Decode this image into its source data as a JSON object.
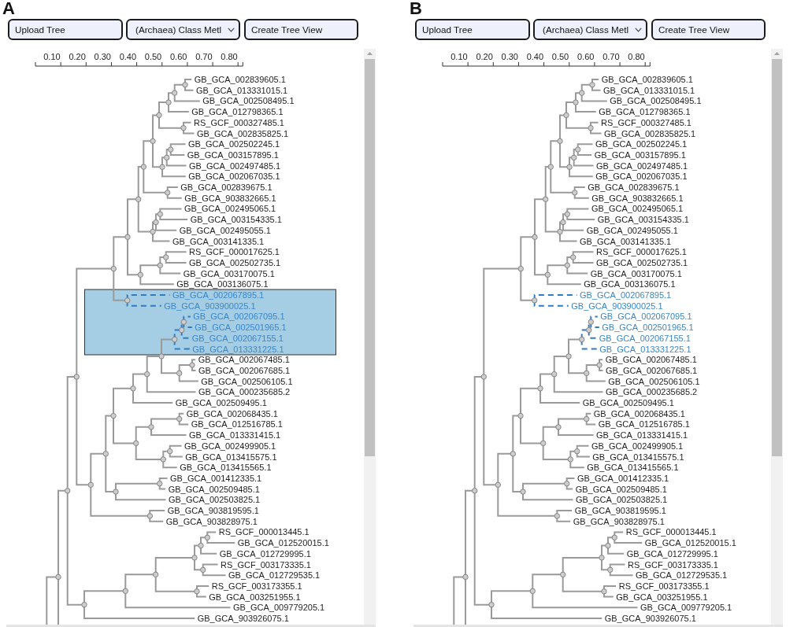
{
  "panels": [
    {
      "label": "A",
      "toolbar": {
        "upload_button": {
          "label": "Upload Tree"
        },
        "class_dropdown": {
          "value": "(Archaea) Class Metl"
        },
        "create_button": {
          "label": "Create Tree View"
        }
      },
      "scale": {
        "tick_labels": [
          "0.10",
          "0.20",
          "0.30",
          "0.40",
          "0.50",
          "0.60",
          "0.70",
          "0.80"
        ]
      },
      "brush_selection": true,
      "tree": {
        "children": [
          {
            "children": [
              {
                "children": [
                  {
                    "children": [
                      {
                        "children": [
                          {
                            "children": [
                              {
                                "children": [
                                  {
                                    "children": [
                                      {
                                        "children": [
                                          {
                                            "children": [
                                              {
                                                "children": [
                                                  {
                                                    "label": "GB_GCA_002839605.1",
                                                    "selected": false
                                                  },
                                                  {
                                                    "label": "GB_GCA_013331015.1",
                                                    "selected": false
                                                  }
                                                ]
                                              },
                                              {
                                                "label": "GB_GCA_002508495.1",
                                                "selected": false
                                              }
                                            ]
                                          },
                                          {
                                            "label": "GB_GCA_012798365.1",
                                            "selected": false
                                          }
                                        ]
                                      },
                                      {
                                        "children": [
                                          {
                                            "label": "RS_GCF_000327485.1",
                                            "selected": false
                                          },
                                          {
                                            "label": "GB_GCA_002835825.1",
                                            "selected": false
                                          }
                                        ]
                                      }
                                    ]
                                  },
                                  {
                                    "children": [
                                      {
                                        "children": [
                                          {
                                            "children": [
                                              {
                                                "label": "GB_GCA_002502245.1",
                                                "selected": false
                                              },
                                              {
                                                "label": "GB_GCA_003157895.1",
                                                "selected": false
                                              }
                                            ]
                                          },
                                          {
                                            "label": "GB_GCA_002497485.1",
                                            "selected": false
                                          }
                                        ]
                                      },
                                      {
                                        "label": "GB_GCA_002067035.1",
                                        "selected": false
                                      }
                                    ]
                                  }
                                ]
                              },
                              {
                                "children": [
                                  {
                                    "label": "GB_GCA_002839675.1",
                                    "selected": false
                                  },
                                  {
                                    "label": "GB_GCA_903832665.1",
                                    "selected": false
                                  }
                                ]
                              }
                            ]
                          },
                          {
                            "children": [
                              {
                                "children": [
                                  {
                                    "children": [
                                      {
                                        "label": "GB_GCA_002495065.1",
                                        "selected": false
                                      },
                                      {
                                        "label": "GB_GCA_003154335.1",
                                        "selected": false
                                      }
                                    ]
                                  },
                                  {
                                    "label": "GB_GCA_002495055.1",
                                    "selected": false
                                  }
                                ]
                              },
                              {
                                "label": "GB_GCA_003141335.1",
                                "selected": false
                              }
                            ]
                          }
                        ]
                      },
                      {
                        "children": [
                          {
                            "children": [
                              {
                                "children": [
                                  {
                                    "label": "RS_GCF_000017625.1",
                                    "selected": false
                                  },
                                  {
                                    "label": "GB_GCA_002502735.1",
                                    "selected": false
                                  }
                                ]
                              },
                              {
                                "label": "GB_GCA_003170075.1",
                                "selected": false
                              }
                            ]
                          },
                          {
                            "label": "GB_GCA_003136075.1",
                            "selected": false
                          }
                        ]
                      }
                    ]
                  },
                  {
                    "children": [
                      {
                        "label": "GB_GCA_002067895.1",
                        "selected": true
                      },
                      {
                        "label": "GB_GCA_903900025.1",
                        "selected": true
                      }
                    ]
                  }
                ]
              },
              {
                "children": [
                  {
                    "children": [
                      {
                        "children": [
                          {
                            "children": [
                              {
                                "children": [
                                  {
                                    "children": [
                                      {
                                        "children": [
                                          {
                                            "children": [
                                              {
                                                "children": [
                                                  {
                                                    "label": "GB_GCA_002067095.1",
                                                    "selected": true
                                                  },
                                                  {
                                                    "label": "GB_GCA_002501965.1",
                                                    "selected": true
                                                  }
                                                ]
                                              },
                                              {
                                                "label": "GB_GCA_002067155.1",
                                                "selected": true
                                              }
                                            ]
                                          },
                                          {
                                            "label": "GB_GCA_013331225.1",
                                            "selected": true
                                          }
                                        ]
                                      },
                                      {
                                        "children": [
                                          {
                                            "children": [
                                              {
                                                "label": "GB_GCA_002067485.1",
                                                "selected": false
                                              },
                                              {
                                                "label": "GB_GCA_002067685.1",
                                                "selected": false
                                              }
                                            ]
                                          },
                                          {
                                            "label": "GB_GCA_002506105.1",
                                            "selected": false
                                          }
                                        ]
                                      }
                                    ]
                                  },
                                  {
                                    "label": "GB_GCA_000235685.2",
                                    "selected": false
                                  }
                                ]
                              },
                              {
                                "label": "GB_GCA_002509495.1",
                                "selected": false
                              }
                            ]
                          },
                          {
                            "children": [
                              {
                                "children": [
                                  {
                                    "children": [
                                      {
                                        "label": "GB_GCA_002068435.1",
                                        "selected": false
                                      },
                                      {
                                        "label": "GB_GCA_012516785.1",
                                        "selected": false
                                      }
                                    ]
                                  },
                                  {
                                    "label": "GB_GCA_013331415.1",
                                    "selected": false
                                  }
                                ]
                              },
                              {
                                "children": [
                                  {
                                    "children": [
                                      {
                                        "label": "GB_GCA_002499905.1",
                                        "selected": false
                                      },
                                      {
                                        "label": "GB_GCA_013415575.1",
                                        "selected": false
                                      }
                                    ]
                                  },
                                  {
                                    "label": "GB_GCA_013415565.1",
                                    "selected": false
                                  }
                                ]
                              }
                            ]
                          }
                        ]
                      },
                      {
                        "children": [
                          {
                            "children": [
                              {
                                "label": "GB_GCA_001412335.1",
                                "selected": false
                              },
                              {
                                "label": "GB_GCA_002509485.1",
                                "selected": false
                              }
                            ]
                          },
                          {
                            "label": "GB_GCA_002503825.1",
                            "selected": false
                          }
                        ]
                      }
                    ]
                  },
                  {
                    "children": [
                      {
                        "label": "GB_GCA_903819595.1",
                        "selected": false
                      },
                      {
                        "label": "GB_GCA_903828975.1",
                        "selected": false
                      }
                    ]
                  }
                ]
              }
            ]
          },
          {
            "children": [
              {
                "children": [
                  {
                    "children": [
                      {
                        "children": [
                          {
                            "children": [
                              {
                                "children": [
                                  {
                                    "label": "RS_GCF_000013445.1",
                                    "selected": false
                                  },
                                  {
                                    "label": "GB_GCA_012520015.1",
                                    "selected": false
                                  }
                                ]
                              },
                              {
                                "label": "GB_GCA_012729995.1",
                                "selected": false
                              }
                            ]
                          },
                          {
                            "children": [
                              {
                                "label": "RS_GCF_003173335.1",
                                "selected": false
                              },
                              {
                                "label": "GB_GCA_012729535.1",
                                "selected": false
                              }
                            ]
                          }
                        ]
                      },
                      {
                        "children": [
                          {
                            "label": "RS_GCF_003173355.1",
                            "selected": false
                          },
                          {
                            "label": "GB_GCA_003251955.1",
                            "selected": false
                          }
                        ]
                      }
                    ]
                  },
                  {
                    "label": "GB_GCA_009779205.1",
                    "selected": false
                  }
                ]
              },
              {
                "label": "GB_GCA_903926075.1",
                "selected": false
              }
            ]
          }
        ]
      }
    },
    {
      "label": "B",
      "toolbar": {
        "upload_button": {
          "label": "Upload Tree"
        },
        "class_dropdown": {
          "value": "(Archaea) Class Metl"
        },
        "create_button": {
          "label": "Create Tree View"
        }
      },
      "scale": {
        "tick_labels": [
          "0.10",
          "0.20",
          "0.30",
          "0.40",
          "0.50",
          "0.60",
          "0.70",
          "0.80"
        ]
      },
      "tree": {
        "children": [
          {
            "children": [
              {
                "children": [
                  {
                    "children": [
                      {
                        "children": [
                          {
                            "children": [
                              {
                                "children": [
                                  {
                                    "children": [
                                      {
                                        "children": [
                                          {
                                            "children": [
                                              {
                                                "children": [
                                                  {
                                                    "label": "GB_GCA_002839605.1",
                                                    "selected": false
                                                  },
                                                  {
                                                    "label": "GB_GCA_013331015.1",
                                                    "selected": false
                                                  }
                                                ]
                                              },
                                              {
                                                "label": "GB_GCA_002508495.1",
                                                "selected": false
                                              }
                                            ]
                                          },
                                          {
                                            "label": "GB_GCA_012798365.1",
                                            "selected": false
                                          }
                                        ]
                                      },
                                      {
                                        "children": [
                                          {
                                            "label": "RS_GCF_000327485.1",
                                            "selected": false
                                          },
                                          {
                                            "label": "GB_GCA_002835825.1",
                                            "selected": false
                                          }
                                        ]
                                      }
                                    ]
                                  },
                                  {
                                    "children": [
                                      {
                                        "children": [
                                          {
                                            "children": [
                                              {
                                                "label": "GB_GCA_002502245.1",
                                                "selected": false
                                              },
                                              {
                                                "label": "GB_GCA_003157895.1",
                                                "selected": false
                                              }
                                            ]
                                          },
                                          {
                                            "label": "GB_GCA_002497485.1",
                                            "selected": false
                                          }
                                        ]
                                      },
                                      {
                                        "label": "GB_GCA_002067035.1",
                                        "selected": false
                                      }
                                    ]
                                  }
                                ]
                              },
                              {
                                "children": [
                                  {
                                    "label": "GB_GCA_002839675.1",
                                    "selected": false
                                  },
                                  {
                                    "label": "GB_GCA_903832665.1",
                                    "selected": false
                                  }
                                ]
                              }
                            ]
                          },
                          {
                            "children": [
                              {
                                "children": [
                                  {
                                    "children": [
                                      {
                                        "label": "GB_GCA_002495065.1",
                                        "selected": false
                                      },
                                      {
                                        "label": "GB_GCA_003154335.1",
                                        "selected": false
                                      }
                                    ]
                                  },
                                  {
                                    "label": "GB_GCA_002495055.1",
                                    "selected": false
                                  }
                                ]
                              },
                              {
                                "label": "GB_GCA_003141335.1",
                                "selected": false
                              }
                            ]
                          }
                        ]
                      },
                      {
                        "children": [
                          {
                            "children": [
                              {
                                "children": [
                                  {
                                    "label": "RS_GCF_000017625.1",
                                    "selected": false
                                  },
                                  {
                                    "label": "GB_GCA_002502735.1",
                                    "selected": false
                                  }
                                ]
                              },
                              {
                                "label": "GB_GCA_003170075.1",
                                "selected": false
                              }
                            ]
                          },
                          {
                            "label": "GB_GCA_003136075.1",
                            "selected": false
                          }
                        ]
                      }
                    ]
                  },
                  {
                    "children": [
                      {
                        "label": "GB_GCA_002067895.1",
                        "selected": true
                      },
                      {
                        "label": "GB_GCA_903900025.1",
                        "selected": true
                      }
                    ]
                  }
                ]
              },
              {
                "children": [
                  {
                    "children": [
                      {
                        "children": [
                          {
                            "children": [
                              {
                                "children": [
                                  {
                                    "children": [
                                      {
                                        "children": [
                                          {
                                            "children": [
                                              {
                                                "children": [
                                                  {
                                                    "label": "GB_GCA_002067095.1",
                                                    "selected": true
                                                  },
                                                  {
                                                    "label": "GB_GCA_002501965.1",
                                                    "selected": true
                                                  }
                                                ]
                                              },
                                              {
                                                "label": "GB_GCA_002067155.1",
                                                "selected": true
                                              }
                                            ]
                                          },
                                          {
                                            "label": "GB_GCA_013331225.1",
                                            "selected": true
                                          }
                                        ]
                                      },
                                      {
                                        "children": [
                                          {
                                            "children": [
                                              {
                                                "label": "GB_GCA_002067485.1",
                                                "selected": false
                                              },
                                              {
                                                "label": "GB_GCA_002067685.1",
                                                "selected": false
                                              }
                                            ]
                                          },
                                          {
                                            "label": "GB_GCA_002506105.1",
                                            "selected": false
                                          }
                                        ]
                                      }
                                    ]
                                  },
                                  {
                                    "label": "GB_GCA_000235685.2",
                                    "selected": false
                                  }
                                ]
                              },
                              {
                                "label": "GB_GCA_002509495.1",
                                "selected": false
                              }
                            ]
                          },
                          {
                            "children": [
                              {
                                "children": [
                                  {
                                    "children": [
                                      {
                                        "label": "GB_GCA_002068435.1",
                                        "selected": false
                                      },
                                      {
                                        "label": "GB_GCA_012516785.1",
                                        "selected": false
                                      }
                                    ]
                                  },
                                  {
                                    "label": "GB_GCA_013331415.1",
                                    "selected": false
                                  }
                                ]
                              },
                              {
                                "children": [
                                  {
                                    "children": [
                                      {
                                        "label": "GB_GCA_002499905.1",
                                        "selected": false
                                      },
                                      {
                                        "label": "GB_GCA_013415575.1",
                                        "selected": false
                                      }
                                    ]
                                  },
                                  {
                                    "label": "GB_GCA_013415565.1",
                                    "selected": false
                                  }
                                ]
                              }
                            ]
                          }
                        ]
                      },
                      {
                        "children": [
                          {
                            "children": [
                              {
                                "label": "GB_GCA_001412335.1",
                                "selected": false
                              },
                              {
                                "label": "GB_GCA_002509485.1",
                                "selected": false
                              }
                            ]
                          },
                          {
                            "label": "GB_GCA_002503825.1",
                            "selected": false
                          }
                        ]
                      }
                    ]
                  },
                  {
                    "children": [
                      {
                        "label": "GB_GCA_903819595.1",
                        "selected": false
                      },
                      {
                        "label": "GB_GCA_903828975.1",
                        "selected": false
                      }
                    ]
                  }
                ]
              }
            ]
          },
          {
            "children": [
              {
                "children": [
                  {
                    "children": [
                      {
                        "children": [
                          {
                            "children": [
                              {
                                "children": [
                                  {
                                    "label": "RS_GCF_000013445.1",
                                    "selected": false
                                  },
                                  {
                                    "label": "GB_GCA_012520015.1",
                                    "selected": false
                                  }
                                ]
                              },
                              {
                                "label": "GB_GCA_012729995.1",
                                "selected": false
                              }
                            ]
                          },
                          {
                            "children": [
                              {
                                "label": "RS_GCF_003173335.1",
                                "selected": false
                              },
                              {
                                "label": "GB_GCA_012729535.1",
                                "selected": false
                              }
                            ]
                          }
                        ]
                      },
                      {
                        "children": [
                          {
                            "label": "RS_GCF_003173355.1",
                            "selected": false
                          },
                          {
                            "label": "GB_GCA_003251955.1",
                            "selected": false
                          }
                        ]
                      }
                    ]
                  },
                  {
                    "label": "GB_GCA_009779205.1",
                    "selected": false
                  }
                ]
              },
              {
                "label": "GB_GCA_903926075.1",
                "selected": false
              }
            ]
          }
        ]
      }
    }
  ]
}
